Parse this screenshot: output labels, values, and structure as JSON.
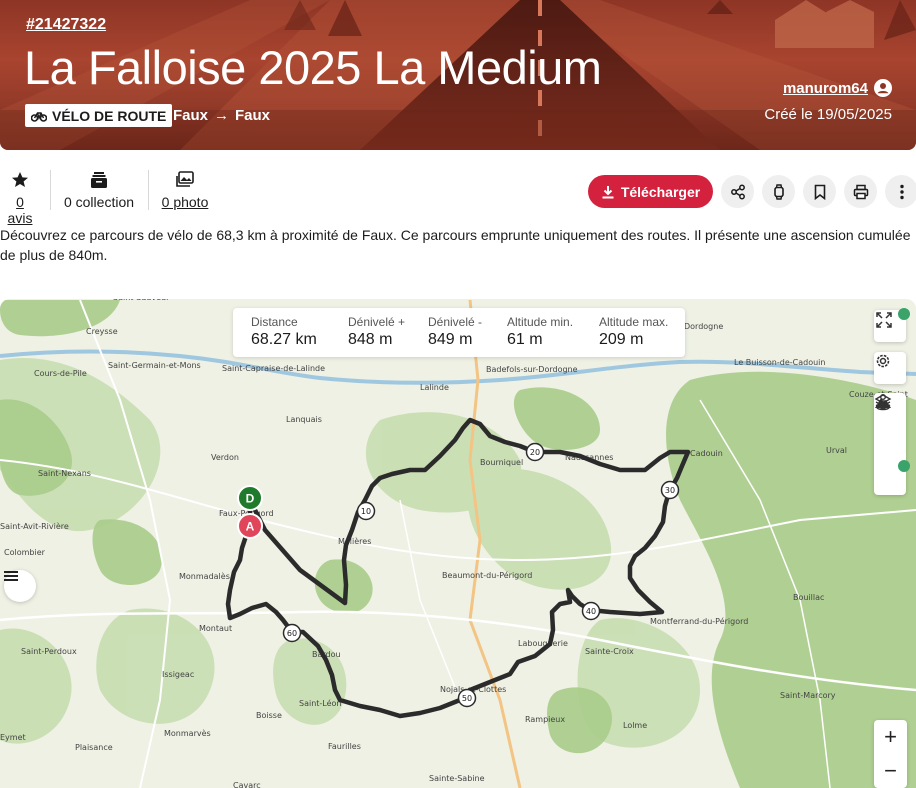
{
  "header": {
    "route_id": "#21427322",
    "title": "La Falloise 2025 La Medium",
    "activity": "VÉLO DE ROUTE",
    "start": "Faux",
    "end": "Faux",
    "arrow": "→",
    "author": "manurom64",
    "created": "Créé le 19/05/2025"
  },
  "stats": {
    "reviews": "0 avis",
    "collections": "0 collection",
    "photos": "0 photo"
  },
  "actions": {
    "download": "Télécharger"
  },
  "description": "Découvrez ce parcours de vélo de 68,3 km à proximité de Faux. Ce parcours emprunte uniquement des routes. Il présente une ascension cumulée de plus de 840m.",
  "map_stats": [
    {
      "label": "Distance",
      "value": "68.27 km"
    },
    {
      "label": "Dénivelé +",
      "value": "848 m"
    },
    {
      "label": "Dénivelé -",
      "value": "849 m"
    },
    {
      "label": "Altitude min.",
      "value": "61 m"
    },
    {
      "label": "Altitude max.",
      "value": "209 m"
    }
  ],
  "markers": {
    "start": "D",
    "end": "A",
    "km": [
      "10",
      "20",
      "30",
      "40",
      "50",
      "60"
    ]
  },
  "zoom": {
    "in": "+",
    "out": "−"
  },
  "places": [
    "Saint-Sauveur",
    "Creysse",
    "Saint-Germain-et-Mons",
    "Cours-de-Pile",
    "Saint-Capraise-de-Lalinde",
    "Lalinde",
    "Badefols-sur-Dordogne",
    "Dordogne",
    "Le Buisson-de-Cadouin",
    "Lanquais",
    "Couze-et-Saint",
    "Saint-Nexans",
    "Verdon",
    "Bourniquel",
    "Urval",
    "Faux-Périgord",
    "Molières",
    "Beaumont-du-Périgord",
    "Colombier",
    "Monmadalès",
    "Montaut",
    "Bouillac",
    "Saint-Perdoux",
    "Labouquerie",
    "Sainte-Croix",
    "Issigeac",
    "Saint-Léon",
    "Nojals-et-Clottes",
    "Saint-Marcory",
    "Boisse",
    "Rampieux",
    "Lolme",
    "Eymet",
    "Monmarvès",
    "Plaisance",
    "Faurilles",
    "Sainte-Sabine",
    "Cavarc",
    "Bardou",
    "Saint-Avit-Rivière",
    "Naussannes",
    "Cadouin",
    "Montferrand-du-Périgord"
  ],
  "colors": {
    "brand_red": "#d4213d",
    "route": "#2b2b2b",
    "start_marker": "#1f7a2c",
    "end_marker": "#e0455a"
  }
}
